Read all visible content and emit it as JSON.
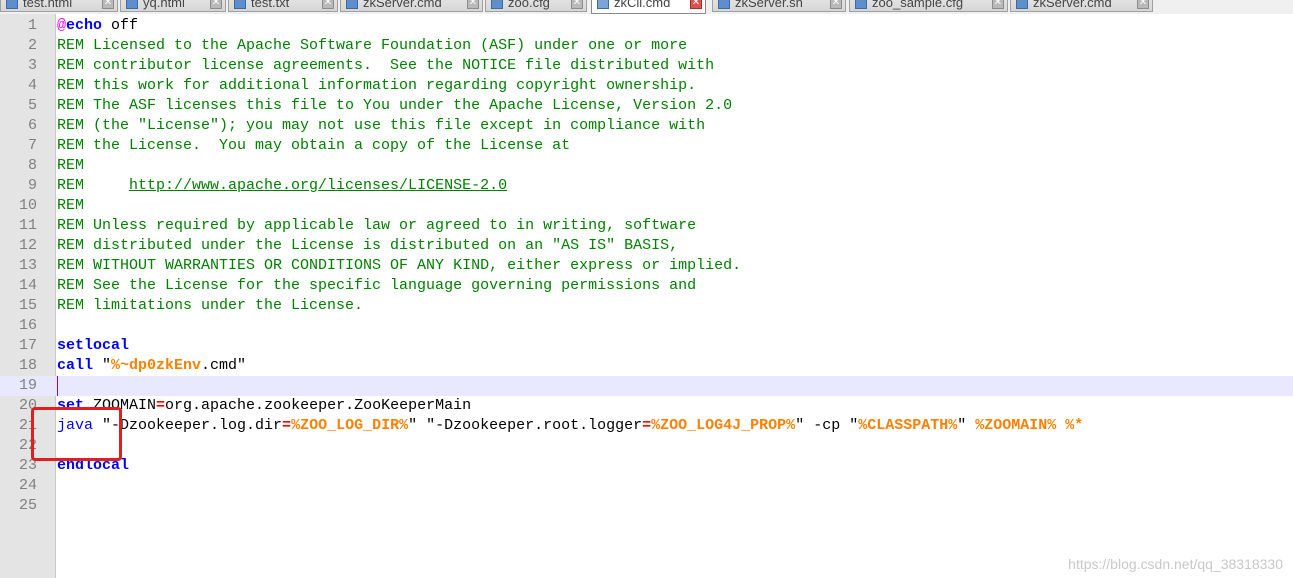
{
  "tabs": [
    {
      "label": "test.html",
      "active": false
    },
    {
      "label": "yq.html",
      "active": false
    },
    {
      "label": "test.txt",
      "active": false
    },
    {
      "label": "zkServer.cmd",
      "active": false
    },
    {
      "label": "zoo.cfg",
      "active": false
    },
    {
      "label": "zkCli.cmd",
      "active": true
    },
    {
      "label": "zkServer.sh",
      "active": false
    },
    {
      "label": "zoo_sample.cfg",
      "active": false
    },
    {
      "label": "zkServer.cmd",
      "active": false
    }
  ],
  "editor": {
    "current_line": 19,
    "lines": [
      {
        "n": "1",
        "tokens": [
          [
            "at",
            "@"
          ],
          [
            "kw",
            "echo"
          ],
          [
            "plain",
            " off"
          ]
        ]
      },
      {
        "n": "2",
        "tokens": [
          [
            "rem",
            "REM Licensed to the Apache Software Foundation (ASF) under one or more"
          ]
        ]
      },
      {
        "n": "3",
        "tokens": [
          [
            "rem",
            "REM contributor license agreements.  See the NOTICE file distributed with"
          ]
        ]
      },
      {
        "n": "4",
        "tokens": [
          [
            "rem",
            "REM this work for additional information regarding copyright ownership."
          ]
        ]
      },
      {
        "n": "5",
        "tokens": [
          [
            "rem",
            "REM The ASF licenses this file to You under the Apache License, Version 2.0"
          ]
        ]
      },
      {
        "n": "6",
        "tokens": [
          [
            "rem",
            "REM (the \"License\"); you may not use this file except in compliance with"
          ]
        ]
      },
      {
        "n": "7",
        "tokens": [
          [
            "rem",
            "REM the License.  You may obtain a copy of the License at"
          ]
        ]
      },
      {
        "n": "8",
        "tokens": [
          [
            "rem",
            "REM"
          ]
        ]
      },
      {
        "n": "9",
        "tokens": [
          [
            "rem",
            "REM     "
          ],
          [
            "url",
            "http://www.apache.org/licenses/LICENSE-2.0"
          ]
        ]
      },
      {
        "n": "10",
        "tokens": [
          [
            "rem",
            "REM"
          ]
        ]
      },
      {
        "n": "11",
        "tokens": [
          [
            "rem",
            "REM Unless required by applicable law or agreed to in writing, software"
          ]
        ]
      },
      {
        "n": "12",
        "tokens": [
          [
            "rem",
            "REM distributed under the License is distributed on an \"AS IS\" BASIS,"
          ]
        ]
      },
      {
        "n": "13",
        "tokens": [
          [
            "rem",
            "REM WITHOUT WARRANTIES OR CONDITIONS OF ANY KIND, either express or implied."
          ]
        ]
      },
      {
        "n": "14",
        "tokens": [
          [
            "rem",
            "REM See the License for the specific language governing permissions and"
          ]
        ]
      },
      {
        "n": "15",
        "tokens": [
          [
            "rem",
            "REM limitations under the License."
          ]
        ]
      },
      {
        "n": "16",
        "tokens": []
      },
      {
        "n": "17",
        "tokens": [
          [
            "kw",
            "setlocal"
          ]
        ]
      },
      {
        "n": "18",
        "tokens": [
          [
            "kw",
            "call"
          ],
          [
            "plain",
            " \""
          ],
          [
            "var",
            "%~dp0zkEnv"
          ],
          [
            "plain",
            ".cmd\""
          ]
        ]
      },
      {
        "n": "19",
        "tokens": []
      },
      {
        "n": "20",
        "tokens": [
          [
            "kw",
            "set"
          ],
          [
            "plain",
            " ZOOMAIN"
          ],
          [
            "op",
            "="
          ],
          [
            "plain",
            "org.apache.zookeeper.ZooKeeperMain"
          ]
        ]
      },
      {
        "n": "21",
        "tokens": [
          [
            "cmd",
            "java"
          ],
          [
            "plain",
            " \"-Dzookeeper.log.dir"
          ],
          [
            "op",
            "="
          ],
          [
            "var",
            "%ZOO_LOG_DIR%"
          ],
          [
            "plain",
            "\" \"-Dzookeeper.root.logger"
          ],
          [
            "op",
            "="
          ],
          [
            "var",
            "%ZOO_LOG4J_PROP%"
          ],
          [
            "plain",
            "\" -cp \""
          ],
          [
            "var",
            "%CLASSPATH%"
          ],
          [
            "plain",
            "\" "
          ],
          [
            "var",
            "%ZOOMAIN%"
          ],
          [
            "plain",
            " "
          ],
          [
            "var",
            "%*"
          ]
        ]
      },
      {
        "n": "22",
        "tokens": []
      },
      {
        "n": "23",
        "tokens": [
          [
            "kw",
            "endlocal"
          ]
        ]
      },
      {
        "n": "24",
        "tokens": []
      },
      {
        "n": "25",
        "tokens": []
      }
    ]
  },
  "watermark": "https://blog.csdn.net/qq_38318330",
  "colors": {
    "comment": "#008000",
    "keyword": "#0000ff",
    "variable": "#ff8000",
    "operator": "#ff0000",
    "current_line": "#e8e8ff",
    "annotation_box": "#e02020"
  }
}
